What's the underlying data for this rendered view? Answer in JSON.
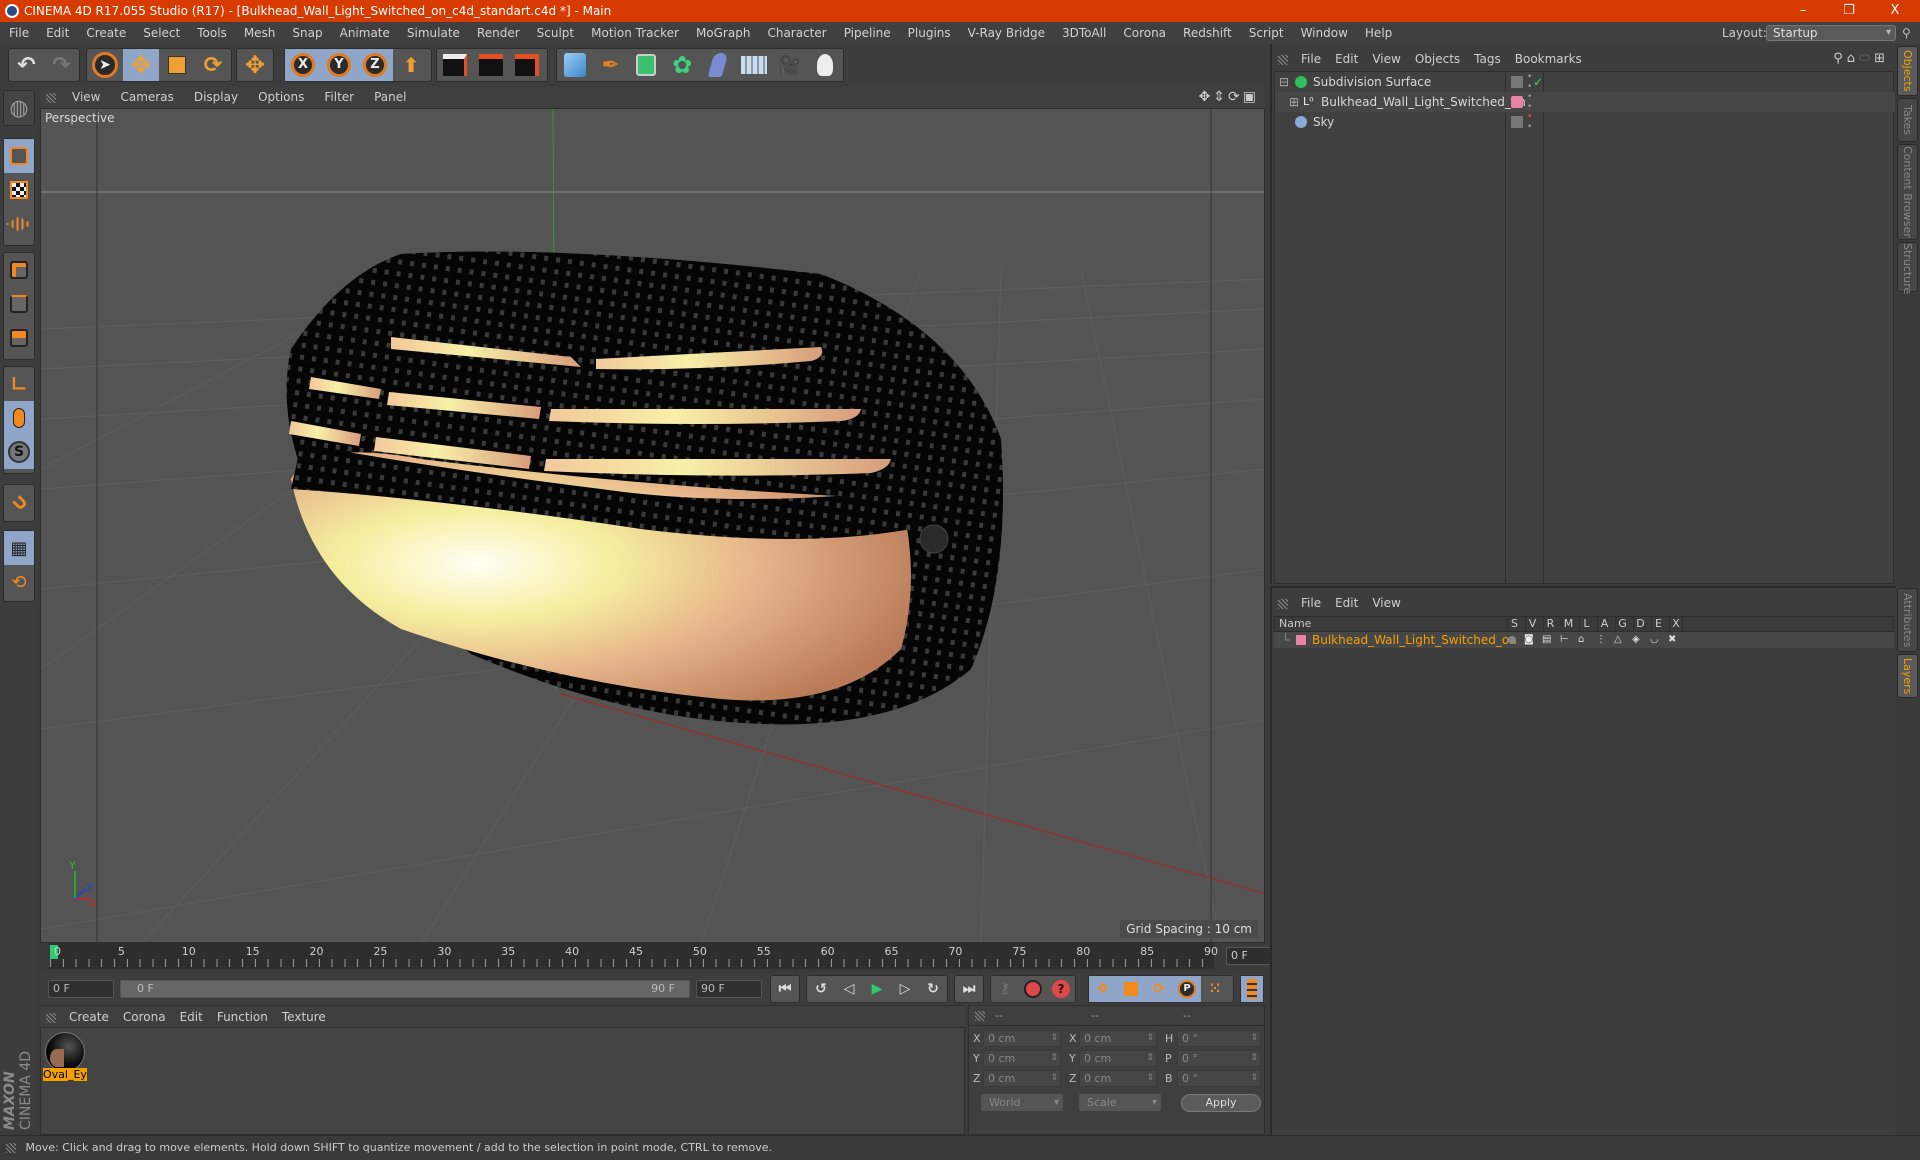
{
  "window": {
    "title": "CINEMA 4D R17.055 Studio (R17) - [Bulkhead_Wall_Light_Switched_on_c4d_standart.c4d *] - Main",
    "controls": {
      "minimize": "–",
      "maximize": "❐",
      "close": "X"
    }
  },
  "menubar": {
    "items": [
      "File",
      "Edit",
      "Create",
      "Select",
      "Tools",
      "Mesh",
      "Snap",
      "Animate",
      "Simulate",
      "Render",
      "Sculpt",
      "Motion Tracker",
      "MoGraph",
      "Character",
      "Pipeline",
      "Plugins",
      "V-Ray Bridge",
      "3DToAll",
      "Corona",
      "Redshift",
      "Script",
      "Window",
      "Help"
    ],
    "layout_label": "Layout:",
    "layout_value": "Startup"
  },
  "toolbar": {
    "undo": "undo-icon",
    "redo": "redo-icon",
    "tools": [
      "select",
      "move",
      "scale",
      "rotate",
      "move-last"
    ],
    "axes": [
      "X",
      "Y",
      "Z"
    ],
    "coord_system": "world-coord-icon",
    "render": [
      "render-view",
      "render-picture-viewer",
      "render-settings"
    ],
    "create": [
      "cube",
      "pen-spline",
      "subdivision",
      "mograph-cloner",
      "deformer",
      "floor",
      "camera",
      "light"
    ]
  },
  "left_tools": [
    "model",
    "texture",
    "workplane",
    "points",
    "edges",
    "polygons",
    "axis",
    "tweak",
    "snap-s",
    "magnet",
    "lock-workplane",
    "workplane-rotate"
  ],
  "viewport": {
    "menu": [
      "View",
      "Cameras",
      "Display",
      "Options",
      "Filter",
      "Panel"
    ],
    "label": "Perspective",
    "grid_spacing": "Grid Spacing : 10 cm",
    "axis_labels": {
      "x": "X",
      "y": "Y",
      "z": "Z"
    }
  },
  "timeline": {
    "ticks": [
      "0",
      "5",
      "10",
      "15",
      "20",
      "25",
      "30",
      "35",
      "40",
      "45",
      "50",
      "55",
      "60",
      "65",
      "70",
      "75",
      "80",
      "85",
      "90"
    ],
    "current_frame": "0 F",
    "start_field": "0 F",
    "range_start": "0 F",
    "range_end": "90 F",
    "end_field": "90 F"
  },
  "material_manager": {
    "menu": [
      "Create",
      "Corona",
      "Edit",
      "Function",
      "Texture"
    ],
    "materials": [
      {
        "name": "Oval_Ey"
      }
    ]
  },
  "brand": {
    "line1": "MAXON",
    "line2": "CINEMA 4D"
  },
  "coordinates": {
    "headers": [
      "--",
      "--",
      "--"
    ],
    "rows": [
      {
        "l1": "X",
        "v1": "0 cm",
        "l2": "X",
        "v2": "0 cm",
        "l3": "H",
        "v3": "0 °"
      },
      {
        "l1": "Y",
        "v1": "0 cm",
        "l2": "Y",
        "v2": "0 cm",
        "l3": "P",
        "v3": "0 °"
      },
      {
        "l1": "Z",
        "v1": "0 cm",
        "l2": "Z",
        "v2": "0 cm",
        "l3": "B",
        "v3": "0 °"
      }
    ],
    "mode": "World",
    "transform": "Scale",
    "apply": "Apply"
  },
  "object_manager": {
    "menu": [
      "File",
      "Edit",
      "View",
      "Objects",
      "Tags",
      "Bookmarks"
    ],
    "objects": [
      {
        "name": "Subdivision Surface",
        "color": "#7a7a7a",
        "check": "✓"
      },
      {
        "name": "Bulkhead_Wall_Light_Switched_on",
        "color": "#e882a6",
        "check": ""
      },
      {
        "name": "Sky",
        "color": "#7a7a7a",
        "check": ""
      }
    ]
  },
  "layer_manager": {
    "menu": [
      "File",
      "Edit",
      "View"
    ],
    "columns": [
      "Name",
      "S",
      "V",
      "R",
      "M",
      "L",
      "A",
      "G",
      "D",
      "E",
      "X"
    ],
    "layers": [
      {
        "name": "Bulkhead_Wall_Light_Switched_on",
        "color": "#e882a6"
      }
    ]
  },
  "right_tabs": {
    "top": [
      "Objects",
      "Takes",
      "Content Browser",
      "Structure"
    ],
    "bottom": [
      "Attributes",
      "Layers"
    ]
  },
  "statusbar": {
    "text": "Move: Click and drag to move elements. Hold down SHIFT to quantize movement / add to the selection in point mode, CTRL to remove."
  },
  "colors": {
    "accent": "#f5a000",
    "titlebar": "#d83b01",
    "selected_tool": "#8fa6c8"
  }
}
